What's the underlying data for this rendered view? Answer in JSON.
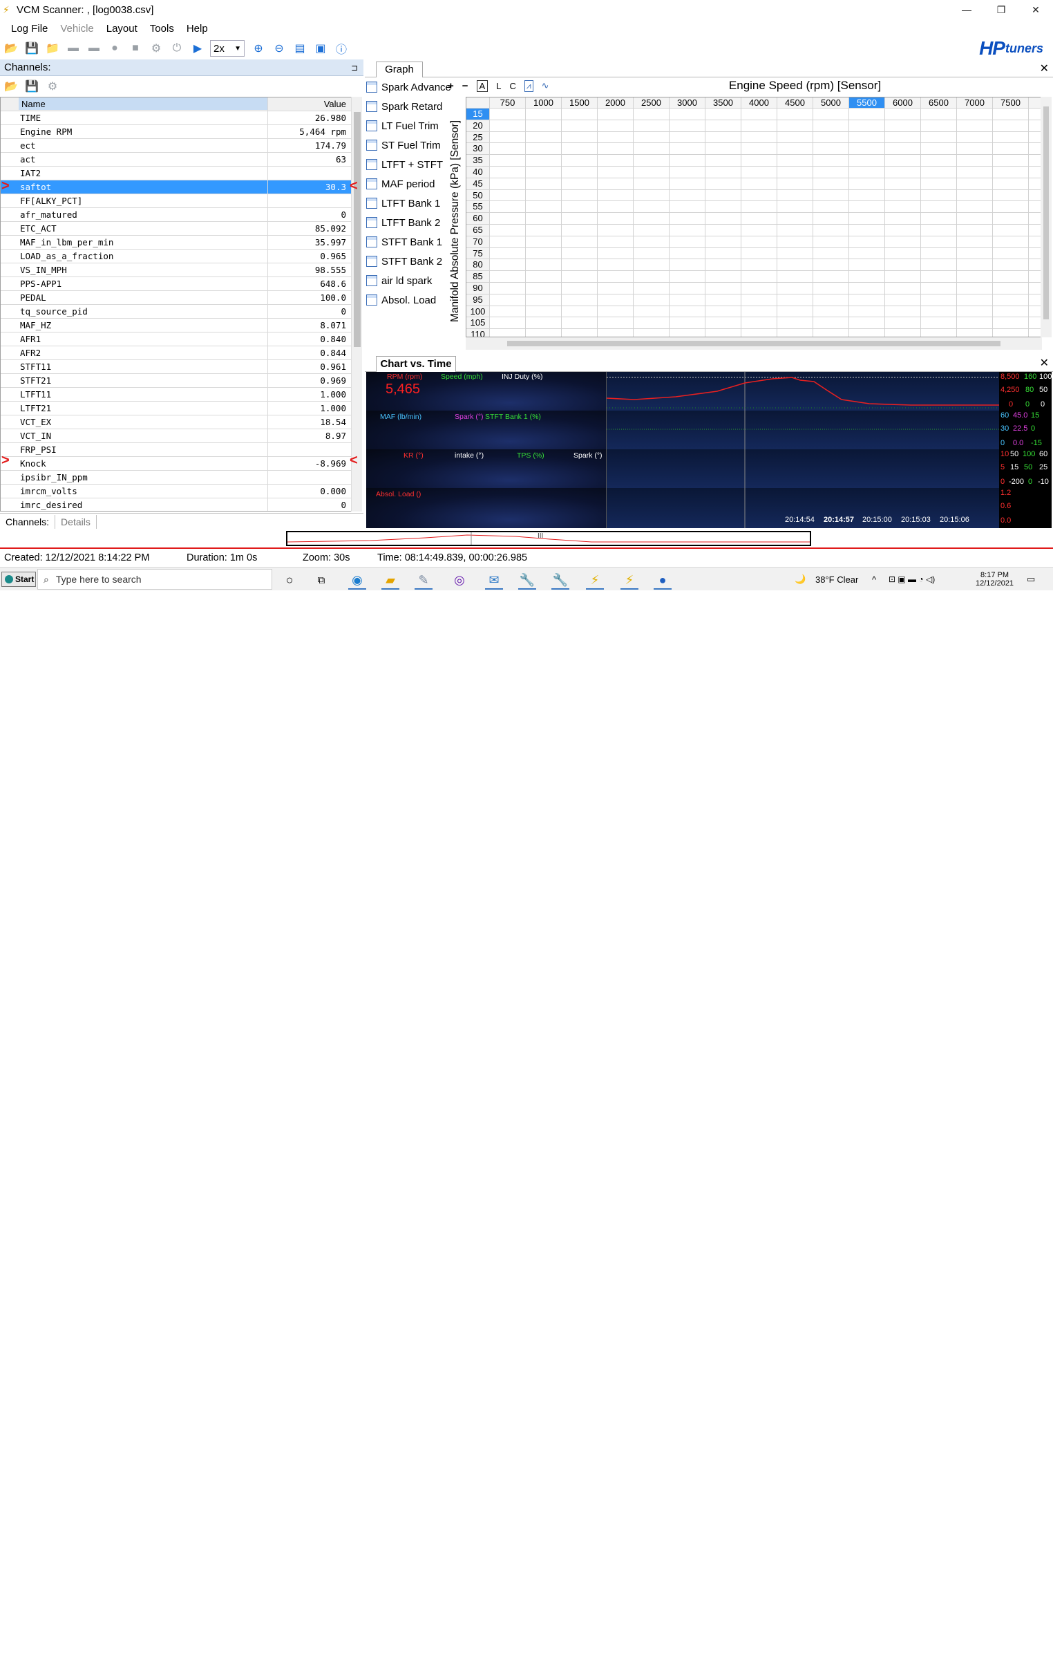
{
  "window": {
    "title": "VCM Scanner: , [log0038.csv]",
    "app_icon": "lightning-icon",
    "min_glyph": "—",
    "max_glyph": "❐",
    "close_glyph": "✕"
  },
  "menu": [
    "Log File",
    "Vehicle",
    "Layout",
    "Tools",
    "Help"
  ],
  "toolbar": {
    "playback_speed": "2x",
    "logo_main": "HP",
    "logo_sub": "tuners"
  },
  "channels": {
    "header": "Channels:",
    "pin": "⊐",
    "col_name": "Name",
    "col_value": "Value",
    "rows": [
      {
        "name": "TIME",
        "value": "26.980"
      },
      {
        "name": "Engine RPM",
        "value": "5,464 rpm"
      },
      {
        "name": "ect",
        "value": "174.79"
      },
      {
        "name": "act",
        "value": "63"
      },
      {
        "name": "IAT2",
        "value": ""
      },
      {
        "name": "saftot",
        "value": "30.3"
      },
      {
        "name": "FF[ALKY_PCT]",
        "value": ""
      },
      {
        "name": "afr_matured",
        "value": "0"
      },
      {
        "name": "ETC_ACT",
        "value": "85.092"
      },
      {
        "name": "MAF_in_lbm_per_min",
        "value": "35.997"
      },
      {
        "name": "LOAD_as_a_fraction",
        "value": "0.965"
      },
      {
        "name": "VS_IN_MPH",
        "value": "98.555"
      },
      {
        "name": "PPS-APP1",
        "value": "648.6"
      },
      {
        "name": "PEDAL",
        "value": "100.0"
      },
      {
        "name": "tq_source_pid",
        "value": "0"
      },
      {
        "name": "MAF_HZ",
        "value": "8.071"
      },
      {
        "name": "AFR1",
        "value": "0.840"
      },
      {
        "name": "AFR2",
        "value": "0.844"
      },
      {
        "name": "STFT11",
        "value": "0.961"
      },
      {
        "name": "STFT21",
        "value": "0.969"
      },
      {
        "name": "LTFT11",
        "value": "1.000"
      },
      {
        "name": "LTFT21",
        "value": "1.000"
      },
      {
        "name": "VCT_EX",
        "value": "18.54"
      },
      {
        "name": "VCT_IN",
        "value": "8.97"
      },
      {
        "name": "FRP_PSI",
        "value": ""
      },
      {
        "name": "Knock",
        "value": "-8.969"
      },
      {
        "name": "ipsibr_IN_ppm",
        "value": ""
      },
      {
        "name": "imrcm_volts",
        "value": "0.000"
      },
      {
        "name": "imrc_desired",
        "value": "0"
      }
    ],
    "tabs": [
      "Channels:",
      "Details"
    ]
  },
  "graph": {
    "tab": "Graph",
    "close": "✕",
    "list": [
      "Spark Advance",
      "Spark Retard",
      "LT Fuel Trim",
      "ST Fuel Trim",
      "LTFT + STFT",
      "MAF period",
      "LTFT Bank 1",
      "LTFT Bank 2",
      "STFT Bank 1",
      "STFT Bank 2",
      "air ld spark",
      "Absol. Load"
    ],
    "controls": [
      "+",
      "−",
      "A",
      "L",
      "C"
    ],
    "x_axis_title": "Engine Speed (rpm) [Sensor]",
    "y_axis_title": "Manifold Absolute Pressure (kPa) [Sensor]",
    "col_headers": [
      "750",
      "1000",
      "1500",
      "2000",
      "2500",
      "3000",
      "3500",
      "4000",
      "4500",
      "5000",
      "5500",
      "6000",
      "6500",
      "7000",
      "7500",
      "8("
    ],
    "row_headers": [
      "15",
      "20",
      "25",
      "30",
      "35",
      "40",
      "45",
      "50",
      "55",
      "60",
      "65",
      "70",
      "75",
      "80",
      "85",
      "90",
      "95",
      "100",
      "105",
      "110"
    ],
    "highlight_col": "5500",
    "highlight_row": "15"
  },
  "cvt": {
    "tab": "Chart vs. Time",
    "close": "✕",
    "strip1": {
      "labels": [
        "RPM (rpm)",
        "Speed (mph)",
        "INJ Duty (%)"
      ],
      "big_value": "5,465",
      "axis": [
        [
          "8,500",
          "160",
          "100"
        ],
        [
          "4,250",
          "80",
          "50"
        ],
        [
          "0",
          "0",
          "0"
        ]
      ]
    },
    "strip2": {
      "labels": [
        "MAF (lb/min)",
        "Spark (°)",
        "STFT Bank 1 (%)"
      ],
      "axis": [
        [
          "60",
          "45.0",
          "15"
        ],
        [
          "30",
          "22.5",
          "0"
        ],
        [
          "0",
          "0.0",
          "-15"
        ]
      ]
    },
    "strip3": {
      "labels": [
        "KR (°)",
        "intake (°)",
        "TPS (%)",
        "Spark (°)"
      ],
      "axis": [
        [
          "10",
          "50",
          "100",
          "60"
        ],
        [
          "5",
          "15",
          "50",
          "25"
        ],
        [
          "0",
          "-200",
          "0",
          "-10"
        ]
      ]
    },
    "strip4": {
      "labels": [
        "Absol. Load ()"
      ],
      "axis": [
        [
          "1.2"
        ],
        [
          "0.6"
        ],
        [
          "0.0"
        ]
      ]
    },
    "times": [
      "20:14:54",
      "20:14:57",
      "20:15:00",
      "20:15:03",
      "20:15:06"
    ],
    "overview_marker": "III"
  },
  "status": {
    "created": "Created: 12/12/2021 8:14:22 PM",
    "duration": "Duration: 1m 0s",
    "zoom": "Zoom: 30s",
    "time": "Time: 08:14:49.839, 00:00:26.985"
  },
  "taskbar": {
    "start": "Start",
    "search_placeholder": "Type here to search",
    "weather": "38°F  Clear",
    "clock_time": "8:17 PM",
    "clock_date": "12/12/2021"
  },
  "colors": {
    "selection": "#3399ff",
    "annotation_red": "#e31b1b",
    "rpm_red": "#ff2020",
    "strip_bg": "#0e1c44"
  }
}
